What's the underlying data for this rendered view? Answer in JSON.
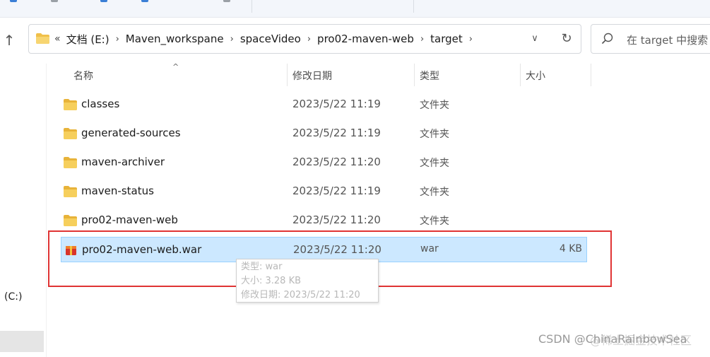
{
  "address": {
    "path": [
      "文档 (E:)",
      "Maven_workspane",
      "spaceVideo",
      "pro02-maven-web",
      "target"
    ]
  },
  "search": {
    "placeholder": "在 target 中搜索"
  },
  "columns": {
    "name": "名称",
    "modified": "修改日期",
    "type": "类型",
    "size": "大小"
  },
  "files": [
    {
      "name": "classes",
      "modified": "2023/5/22 11:19",
      "type": "文件夹",
      "size": "",
      "icon": "folder-icon"
    },
    {
      "name": "generated-sources",
      "modified": "2023/5/22 11:19",
      "type": "文件夹",
      "size": "",
      "icon": "folder-icon"
    },
    {
      "name": "maven-archiver",
      "modified": "2023/5/22 11:20",
      "type": "文件夹",
      "size": "",
      "icon": "folder-icon"
    },
    {
      "name": "maven-status",
      "modified": "2023/5/22 11:19",
      "type": "文件夹",
      "size": "",
      "icon": "folder-icon"
    },
    {
      "name": "pro02-maven-web",
      "modified": "2023/5/22 11:20",
      "type": "文件夹",
      "size": "",
      "icon": "folder-icon"
    },
    {
      "name": "pro02-maven-web.war",
      "modified": "2023/5/22 11:20",
      "type": "war",
      "size": "4 KB",
      "icon": "archive-icon"
    }
  ],
  "tooltip": {
    "type": "类型: war",
    "size": "大小: 3.28 KB",
    "modified": "修改日期: 2023/5/22 11:20"
  },
  "sidebar": {
    "drive": "(C:)"
  },
  "watermark": {
    "text": "CSDN @ChinaRainbowSea",
    "text2": "@稀土掘金技术社区"
  },
  "colors": {
    "folder": "#f0c04a",
    "selection": "#cce8ff",
    "annotation": "#e03434"
  }
}
